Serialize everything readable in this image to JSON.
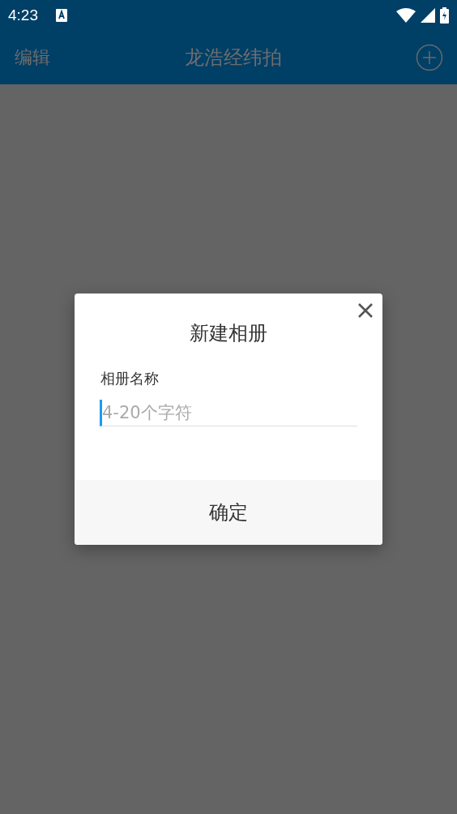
{
  "status_bar": {
    "time": "4:23"
  },
  "app_bar": {
    "left_action": "编辑",
    "title": "龙浩经纬拍"
  },
  "dialog": {
    "title": "新建相册",
    "field_label": "相册名称",
    "field": {
      "placeholder": "4-20个字符"
    },
    "confirm_button": "确定"
  }
}
